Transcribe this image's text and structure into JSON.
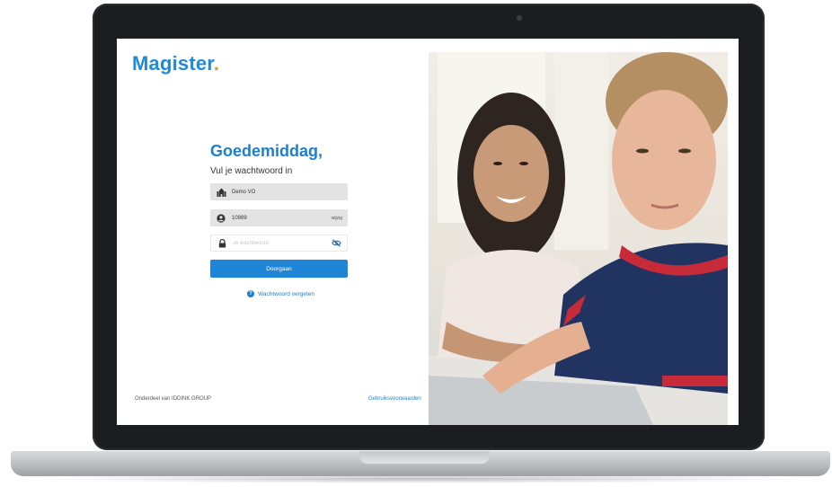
{
  "app": {
    "logo_text": "Magister",
    "logo_dot": "."
  },
  "login": {
    "greeting": "Goedemiddag,",
    "subtitle": "Vul je wachtwoord in",
    "school": "Demo VO",
    "username": "10989",
    "username_tag": "wijzig",
    "password_placeholder": "Je wachtwoord",
    "submit_label": "Doorgaan",
    "forgot_label": "Wachtwoord vergeten"
  },
  "footer": {
    "left": "Onderdeel van IDDINK GROUP",
    "right": "Gebruiksvoorwaarden"
  },
  "icons": {
    "school": "school-icon",
    "user": "user-icon",
    "lock": "lock-icon",
    "visibility": "eye-off-icon",
    "help": "question-icon"
  },
  "colors": {
    "brand_blue": "#1e8ad8",
    "brand_orange": "#f18a1c",
    "button": "#1f85d6"
  }
}
